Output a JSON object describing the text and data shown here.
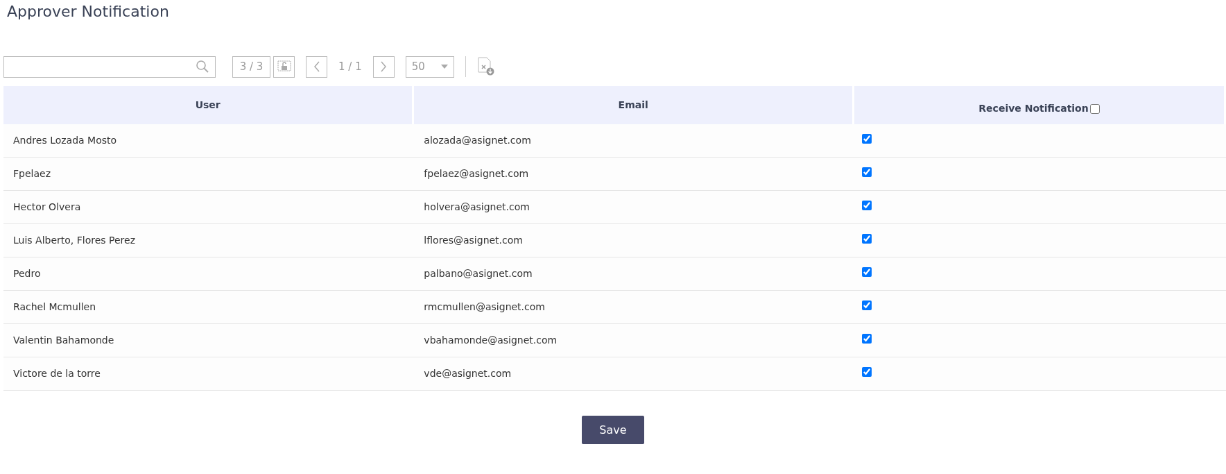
{
  "title": "Approver Notification",
  "toolbar": {
    "count": "3 / 3",
    "page": "1 / 1",
    "page_size": "50"
  },
  "table": {
    "columns": [
      {
        "label": "User"
      },
      {
        "label": "Email"
      },
      {
        "label": "Receive Notification",
        "checkbox_checked": false
      }
    ],
    "rows": [
      {
        "user": "Andres Lozada Mosto",
        "email": "alozada@asignet.com",
        "checked": true
      },
      {
        "user": "Fpelaez",
        "email": "fpelaez@asignet.com",
        "checked": true
      },
      {
        "user": "Hector Olvera",
        "email": "holvera@asignet.com",
        "checked": true
      },
      {
        "user": "Luis Alberto, Flores Perez",
        "email": "lflores@asignet.com",
        "checked": true
      },
      {
        "user": "Pedro",
        "email": "palbano@asignet.com",
        "checked": true
      },
      {
        "user": "Rachel Mcmullen",
        "email": "rmcmullen@asignet.com",
        "checked": true
      },
      {
        "user": "Valentin Bahamonde",
        "email": "vbahamonde@asignet.com",
        "checked": true
      },
      {
        "user": "Victore de la torre",
        "email": "vde@asignet.com",
        "checked": true
      }
    ]
  },
  "save_button": "Save"
}
